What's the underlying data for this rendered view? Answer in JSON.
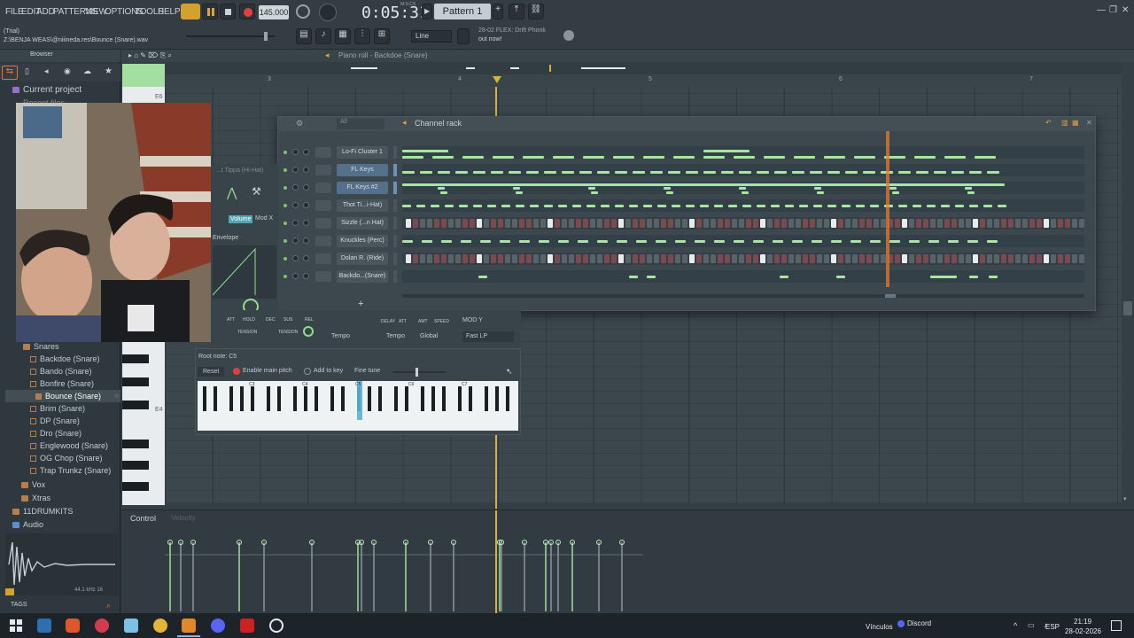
{
  "menu": [
    "FILE",
    "EDIT",
    "ADD",
    "PATTERNS",
    "VIEW",
    "OPTIONS",
    "TOOLS",
    "HELP"
  ],
  "transport": {
    "tempo": "145.000",
    "time": "0:05:31",
    "time_unit": "M:S:CS",
    "pattern": "Pattern 1"
  },
  "file_info": {
    "line1": "(Trial)",
    "line2": "Z:\\BENJA WEAS\\@niiineda.res\\Bounce (Snare).wav"
  },
  "snap_mode": "Line",
  "news": {
    "line1": "28-02 FLEX: Drift Phonk",
    "line2": "out now!"
  },
  "browser": {
    "title": "Browser",
    "header": "Current project",
    "faded_item": "Recent files",
    "folder_snares": "Snares",
    "files": [
      "Backdoe (Snare)",
      "Bando (Snare)",
      "Bonfire (Snare)",
      "Bounce (Snare)",
      "Brim (Snare)",
      "DP (Snare)",
      "Dro (Snare)",
      "Englewood (Snare)",
      "OG Chop (Snare)",
      "Trap Trunkz (Snare)"
    ],
    "folders_after": [
      "Vox",
      "Xtras",
      "11DRUMKITS",
      "Audio"
    ],
    "waveform_info": "44.1 kHz 16",
    "tags": "TAGS"
  },
  "pianoroll": {
    "title": "Piano roll - Backdoe (Snare)",
    "key_label_top": "E6",
    "key_label_bottom": "E4",
    "bars": [
      "3",
      "4",
      "5",
      "6",
      "7"
    ]
  },
  "channel_rack": {
    "title": "Channel rack",
    "filter": "All",
    "channels": [
      {
        "name": "Lo-Fi Cluster 1",
        "selected": false
      },
      {
        "name": "FL Keys",
        "selected": true
      },
      {
        "name": "FL Keys #2",
        "selected": true
      },
      {
        "name": "Thot Ti...i-Hat)",
        "selected": false
      },
      {
        "name": "Sizzle (...n Hat)",
        "selected": false
      },
      {
        "name": "Knuckles (Perc)",
        "selected": false
      },
      {
        "name": "Dolan R. (Ride)",
        "selected": false
      },
      {
        "name": "Backdo...(Snare)",
        "selected": false
      }
    ],
    "add_label": "+"
  },
  "instrument": {
    "channel_hint": "...t Tippa (Hi-Hat)",
    "tab_volume": "Volume",
    "tab_mod": "Mod X",
    "envelope": "Envelope",
    "env_labels": [
      "ATT",
      "HOLD",
      "DEC",
      "SUS",
      "REL"
    ],
    "tension": "TENSION",
    "tempo": "Tempo",
    "lfo_labels": [
      "DELAY",
      "ATT",
      "AMT",
      "SPEED"
    ],
    "global": "Global",
    "mod_y": "MOD Y",
    "filter_type": "Fast LP",
    "root_note": "Root note: C5",
    "reset": "Reset",
    "main_pitch": "Enable main pitch",
    "add_to_key": "Add to key",
    "fine_tune": "Fine tune",
    "octaves": [
      "C3",
      "C4",
      "C5",
      "C6",
      "C7"
    ]
  },
  "control": {
    "label": "Control",
    "target": "Velocity"
  },
  "taskbar": {
    "vinculos": "Vínculos",
    "discord": "Discord",
    "lang": "ESP",
    "time": "21:19",
    "date": "28-02-2026"
  },
  "colors": {
    "accent_green": "#9fe09a",
    "playhead": "#d8b13a",
    "record": "#e04040"
  }
}
